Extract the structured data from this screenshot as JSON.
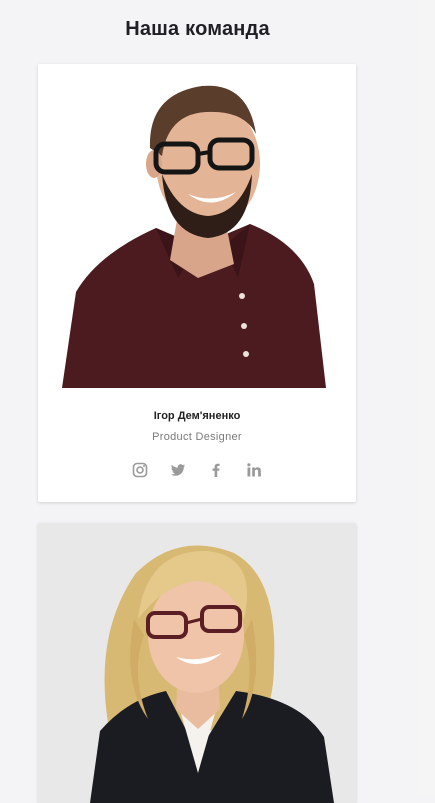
{
  "section": {
    "title": "Наша команда"
  },
  "team": [
    {
      "name": "Ігор Дем'яненко",
      "role": "Product Designer",
      "photo": "man-with-glasses-portrait",
      "socials": [
        "instagram-icon",
        "twitter-icon",
        "facebook-icon",
        "linkedin-icon"
      ]
    },
    {
      "photo": "woman-with-glasses-portrait"
    }
  ],
  "colors": {
    "icon": "#9a9a9a",
    "background": "#f4f4f6",
    "card": "#ffffff"
  }
}
